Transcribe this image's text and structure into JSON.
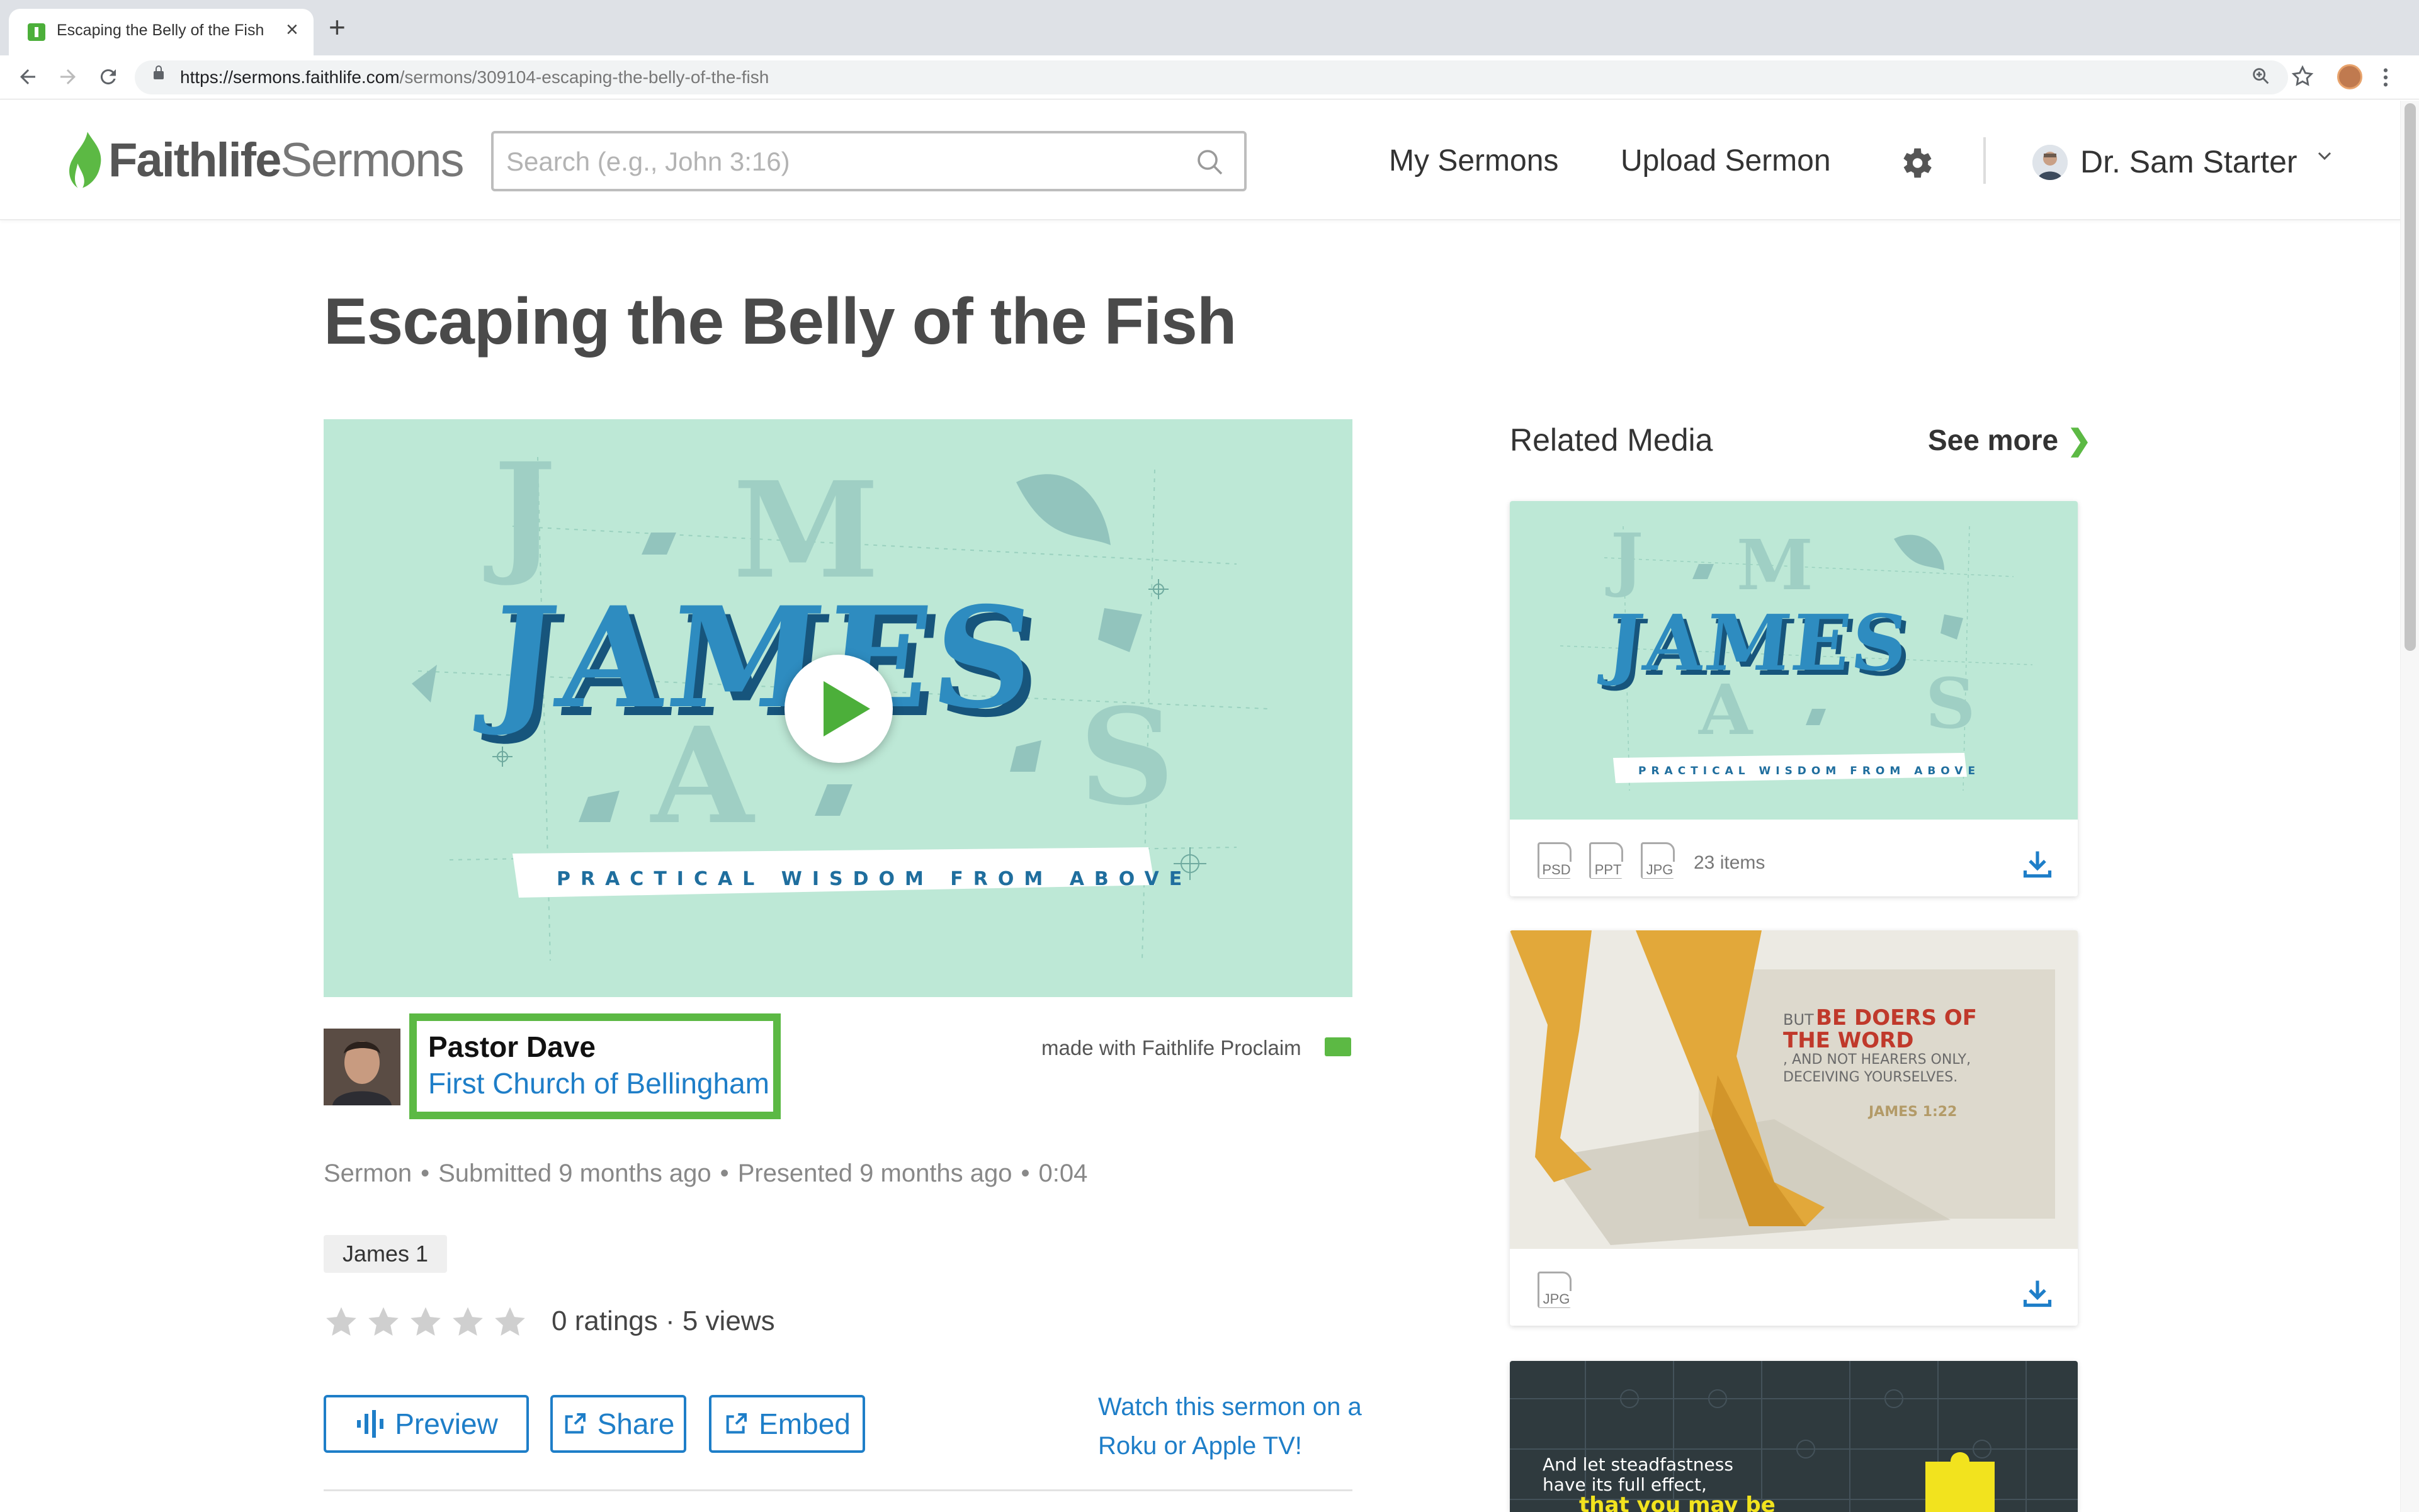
{
  "browser": {
    "tab_title": "Escaping the Belly of the Fish",
    "tab_close": "×",
    "new_tab": "+",
    "url_domain": "https://sermons.faithlife.com",
    "url_path": "/sermons/309104-escaping-the-belly-of-the-fish"
  },
  "header": {
    "brand_primary": "Faithlife",
    "brand_secondary": "Sermons",
    "search_placeholder": "Search (e.g., John 3:16)",
    "nav": [
      "My Sermons",
      "Upload Sermon"
    ],
    "user_name": "Dr. Sam Starter"
  },
  "sermon": {
    "title": "Escaping the Belly of the Fish",
    "video_art": {
      "big_title": "JAMES",
      "letters": [
        "J",
        "M",
        "A",
        "S"
      ],
      "subtitle": "PRACTICAL WISDOM FROM ABOVE"
    },
    "author": "Pastor Dave",
    "church": "First Church of Bellingham",
    "made_with": "made with Faithlife Proclaim",
    "meta": {
      "type": "Sermon",
      "submitted": "Submitted 9 months ago",
      "presented": "Presented 9 months ago",
      "duration": "0:04",
      "separator": "•"
    },
    "tag": "James 1",
    "rating": {
      "stars_filled": 0,
      "stars_total": 5,
      "text": "0 ratings · 5 views"
    },
    "buttons": {
      "preview": "Preview",
      "share": "Share",
      "embed": "Embed"
    },
    "watch_link": "Watch this sermon on a Roku or Apple TV!"
  },
  "related": {
    "title": "Related Media",
    "see_more": "See more",
    "see_more_chevron": "❯",
    "cards": [
      {
        "file_types": [
          "PSD",
          "PPT",
          "JPG"
        ],
        "count": "23 items",
        "art_title": "JAMES",
        "art_letters": [
          "J",
          "M",
          "A",
          "S"
        ],
        "art_subtitle": "PRACTICAL WISDOM FROM ABOVE"
      },
      {
        "file_types": [
          "JPG"
        ],
        "art_lead": "BUT",
        "art_line1": "BE DOERS OF",
        "art_line2": "THE WORD",
        "art_rest": ", AND NOT HEARERS ONLY, DECEIVING YOURSELVES.",
        "art_ref": "JAMES 1:22"
      },
      {
        "art_line1": "And let steadfastness",
        "art_line2": "have its full effect,",
        "art_line3": "that you may be"
      }
    ]
  },
  "colors": {
    "brand_green": "#5cb944",
    "link_blue": "#1e7ec8",
    "video_bg": "#bde8d6",
    "james_blue": "#1f6e9e"
  }
}
